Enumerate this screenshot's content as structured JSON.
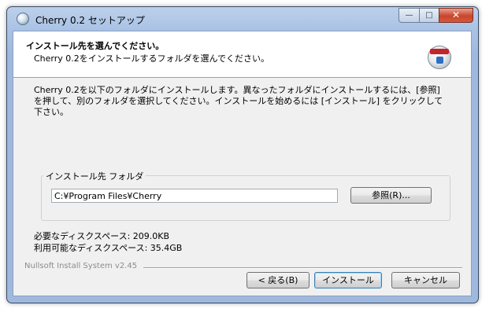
{
  "window": {
    "title": "Cherry 0.2 セットアップ",
    "controls": {
      "minimize": "—",
      "maximize": "□",
      "close": "✕"
    }
  },
  "header": {
    "title": "インストール先を選んでください。",
    "subtitle": "Cherry 0.2をインストールするフォルダを選んでください。"
  },
  "intro": "Cherry 0.2を以下のフォルダにインストールします。異なったフォルダにインストールするには、[参照] を押して、別のフォルダを選択してください。インストールを始めるには [インストール] をクリックして下さい。",
  "destination": {
    "group_label": "インストール先 フォルダ",
    "path": "C:¥Program Files¥Cherry",
    "browse_label": "参照(R)..."
  },
  "space": {
    "required": "必要なディスクスペース: 209.0KB",
    "available": "利用可能なディスクスペース: 35.4GB"
  },
  "branding": "Nullsoft Install System v2.45",
  "buttons": {
    "back": "< 戻る(B)",
    "install": "インストール",
    "cancel": "キャンセル"
  },
  "icons": {
    "app": "cherry-app-icon",
    "header": "installer-disk-icon"
  }
}
